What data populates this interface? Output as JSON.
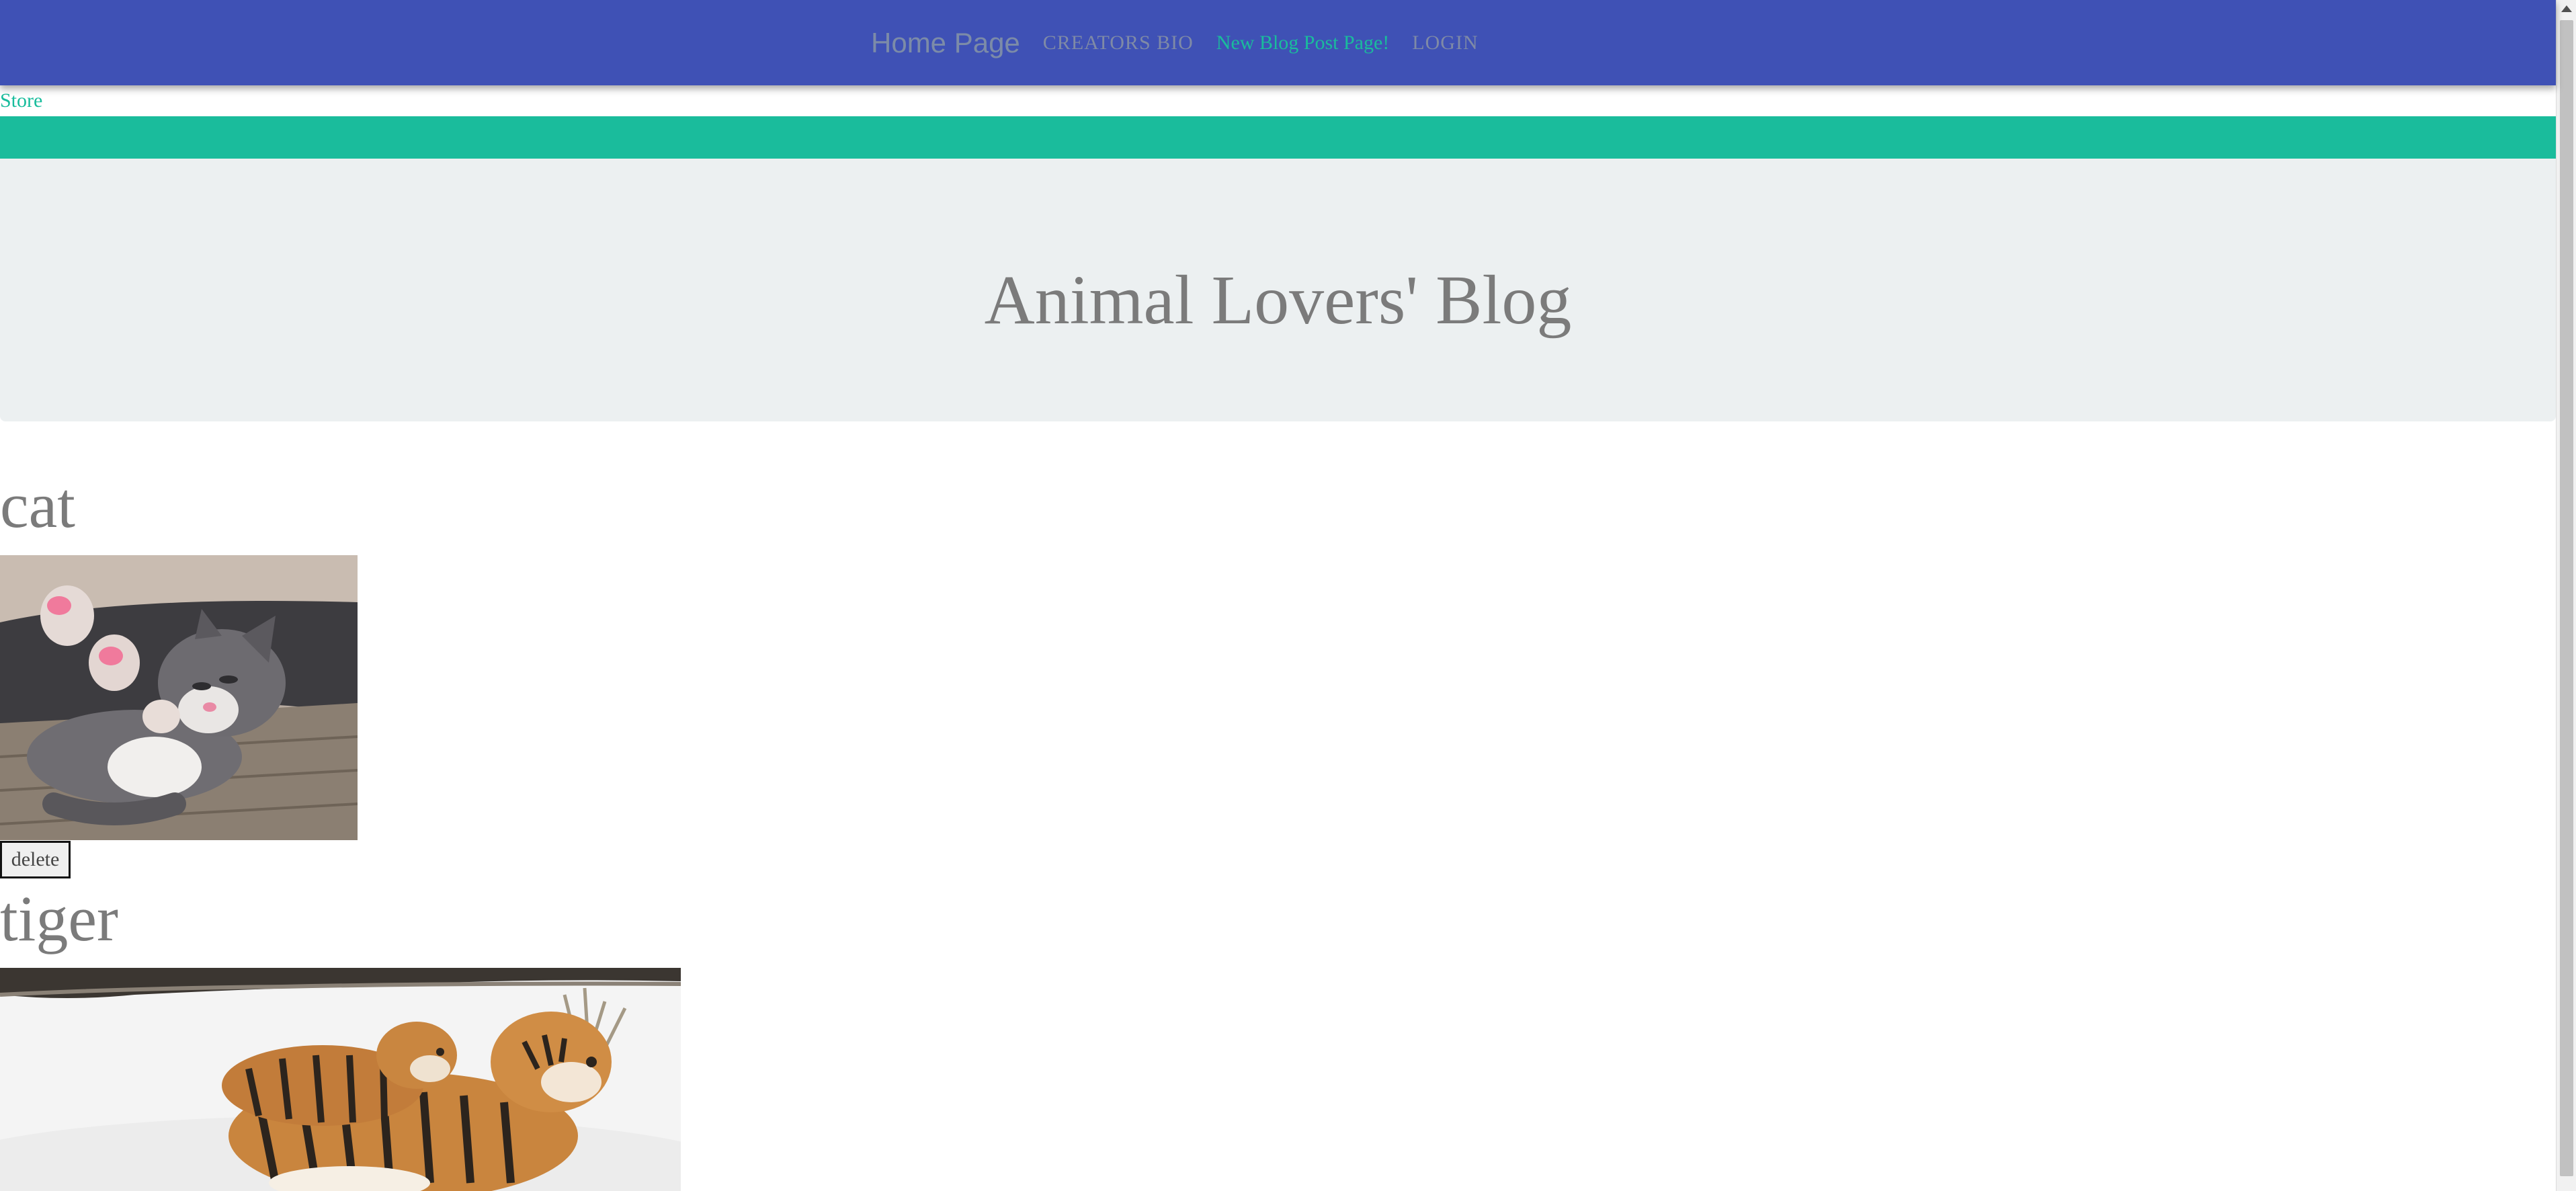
{
  "navbar": {
    "brand": "Home Page",
    "links": [
      {
        "label": "CREATORS BIO"
      },
      {
        "label": "New Blog Post Page!"
      },
      {
        "label": "LOGIN"
      }
    ],
    "colors": {
      "background": "#3f51b5",
      "active": "#1abc9c"
    }
  },
  "store_link": "Store",
  "jumbotron": {
    "title": "Animal Lovers' Blog"
  },
  "posts": [
    {
      "title": "cat",
      "image": "kitten-photo",
      "delete_label": "delete"
    },
    {
      "title": "tiger",
      "image": "tigers-in-snow-photo"
    }
  ],
  "colors": {
    "accent": "#1abc9c",
    "navbar": "#3f51b5",
    "jumbotron": "#ecf0f1",
    "text": "#7b7b7b"
  }
}
